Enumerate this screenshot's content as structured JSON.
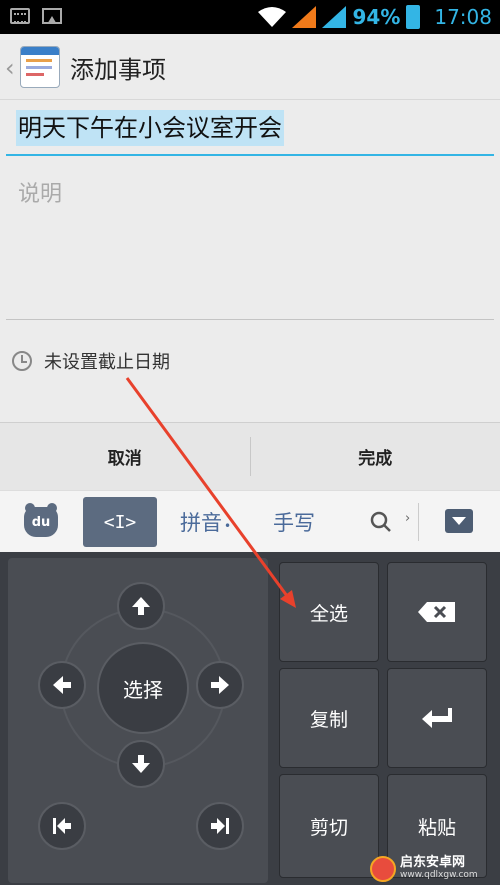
{
  "status_bar": {
    "battery": "94%",
    "time": "17:08"
  },
  "action_bar": {
    "title": "添加事项"
  },
  "form": {
    "title_value": "明天下午在小会议室开会",
    "description_placeholder": "说明",
    "deadline_text": "未设置截止日期"
  },
  "buttons": {
    "cancel": "取消",
    "done": "完成"
  },
  "ime_toolbar": {
    "logo_text": "du",
    "cursor_tab": "<I>",
    "tab_pinyin": "拼音",
    "tab_handwriting": "手写"
  },
  "keyboard": {
    "select": "选择",
    "select_all": "全选",
    "copy": "复制",
    "cut": "剪切",
    "paste": "粘贴"
  },
  "watermark": {
    "name": "启东安卓网",
    "url": "www.qdlxgw.com"
  },
  "colors": {
    "accent": "#33b5e5",
    "annotation_arrow": "#e8412c",
    "keyboard_bg": "#3b3e44"
  }
}
